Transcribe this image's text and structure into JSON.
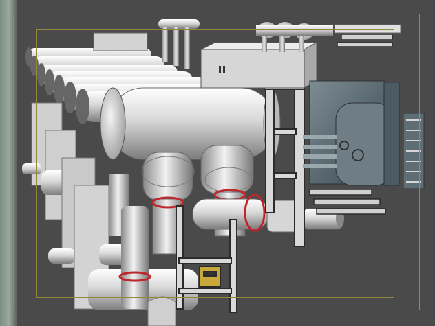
{
  "viewport": {
    "label": "",
    "background_color": "#4a4a4a",
    "safe_frame_color": "#39a6b5",
    "title_safe_color": "#8f8a3a",
    "model": {
      "material_color": "#d9d9d9",
      "shadow_color": "#8a8a8a",
      "flange_accent_color": "#c0272d",
      "steel_color": "#5b6a72"
    }
  }
}
